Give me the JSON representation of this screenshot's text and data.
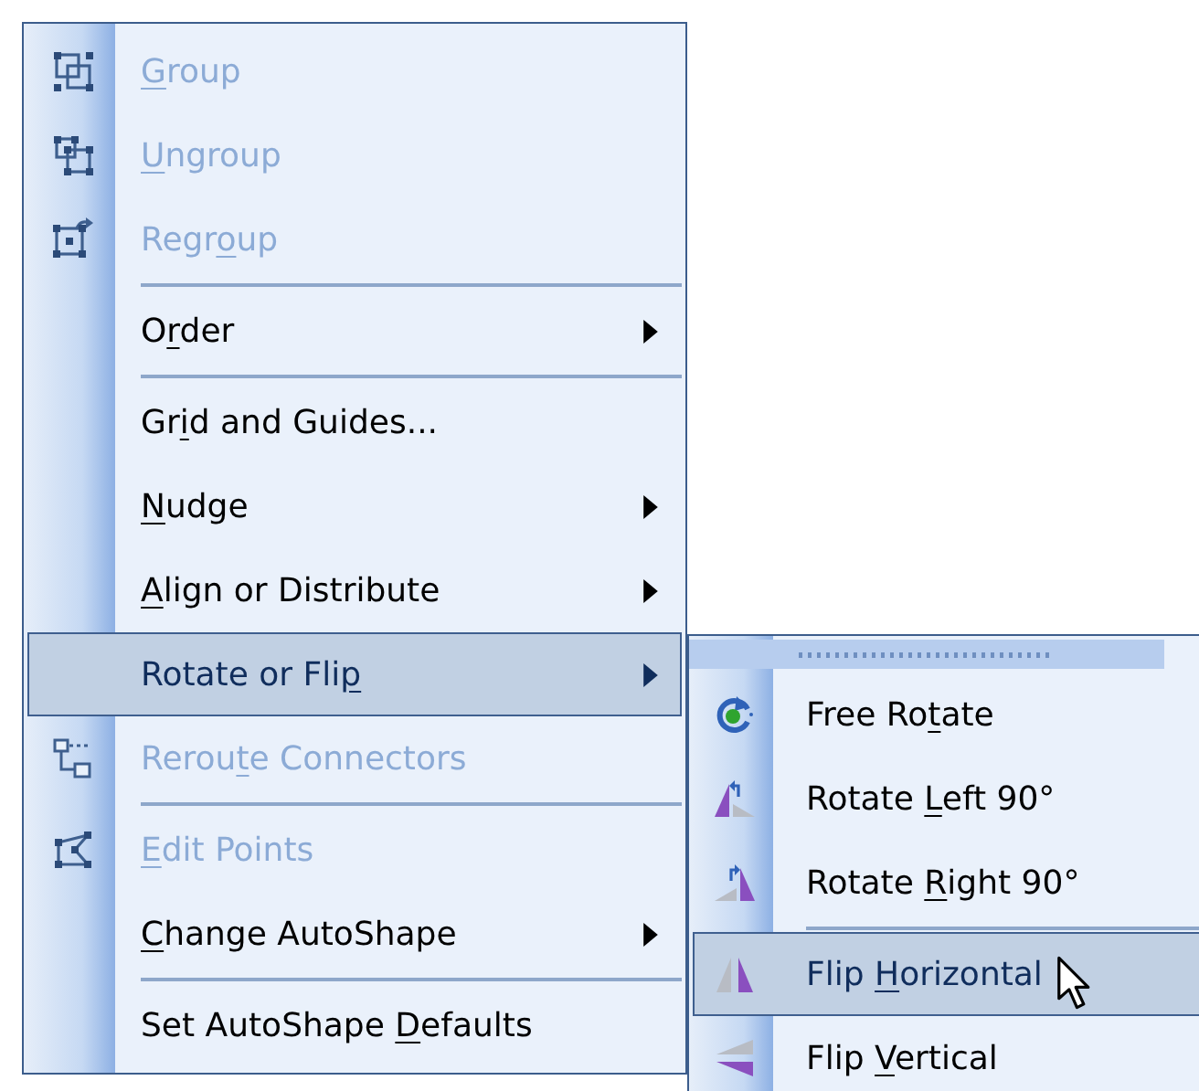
{
  "menu": {
    "items": [
      {
        "kind": "item",
        "label": {
          "key": "G",
          "post": "roup"
        },
        "disabled": true,
        "selected": false,
        "submenu_arrow": false
      },
      {
        "kind": "item",
        "label": {
          "key": "U",
          "post": "ngroup"
        },
        "disabled": true,
        "selected": false,
        "submenu_arrow": false
      },
      {
        "kind": "item",
        "label": {
          "pre": "Regr",
          "key": "o",
          "post": "up"
        },
        "disabled": true,
        "selected": false,
        "submenu_arrow": false
      },
      {
        "kind": "separator"
      },
      {
        "kind": "item",
        "label": {
          "pre": "O",
          "key": "r",
          "post": "der"
        },
        "disabled": false,
        "selected": false,
        "submenu_arrow": true
      },
      {
        "kind": "separator"
      },
      {
        "kind": "item",
        "label": {
          "pre": "Gr",
          "key": "i",
          "post": "d and Guides..."
        },
        "disabled": false,
        "selected": false,
        "submenu_arrow": false
      },
      {
        "kind": "item",
        "label": {
          "key": "N",
          "post": "udge"
        },
        "disabled": false,
        "selected": false,
        "submenu_arrow": true
      },
      {
        "kind": "item",
        "label": {
          "key": "A",
          "post": "lign or Distribute"
        },
        "disabled": false,
        "selected": false,
        "submenu_arrow": true
      },
      {
        "kind": "item",
        "label": {
          "pre": "Rotate or Fli",
          "key": "p"
        },
        "disabled": false,
        "selected": true,
        "submenu_arrow": true
      },
      {
        "kind": "item",
        "label": {
          "pre": "Rerou",
          "key": "t",
          "post": "e Connectors"
        },
        "disabled": true,
        "selected": false,
        "submenu_arrow": false
      },
      {
        "kind": "separator"
      },
      {
        "kind": "item",
        "label": {
          "key": "E",
          "post": "dit Points"
        },
        "disabled": true,
        "selected": false,
        "submenu_arrow": false
      },
      {
        "kind": "item",
        "label": {
          "key": "C",
          "post": "hange AutoShape"
        },
        "disabled": false,
        "selected": false,
        "submenu_arrow": true
      },
      {
        "kind": "separator"
      },
      {
        "kind": "item",
        "label": {
          "pre": "Set AutoShape ",
          "key": "D",
          "post": "efaults"
        },
        "disabled": false,
        "selected": false,
        "submenu_arrow": false
      }
    ]
  },
  "submenu": {
    "items": [
      {
        "kind": "item",
        "label": {
          "pre": "Free Ro",
          "key": "t",
          "post": "ate"
        },
        "disabled": false,
        "selected": false,
        "pointer": false
      },
      {
        "kind": "item",
        "label": {
          "pre": "Rotate ",
          "key": "L",
          "post": "eft 90°"
        },
        "disabled": false,
        "selected": false,
        "pointer": false
      },
      {
        "kind": "item",
        "label": {
          "pre": "Rotate ",
          "key": "R",
          "post": "ight 90°"
        },
        "disabled": false,
        "selected": false,
        "pointer": false
      },
      {
        "kind": "separator"
      },
      {
        "kind": "item",
        "label": {
          "pre": "Flip ",
          "key": "H",
          "post": "orizontal"
        },
        "disabled": false,
        "selected": true,
        "pointer": true
      },
      {
        "kind": "item",
        "label": {
          "pre": "Flip ",
          "key": "V",
          "post": "ertical"
        },
        "disabled": false,
        "selected": false,
        "pointer": false
      }
    ]
  }
}
